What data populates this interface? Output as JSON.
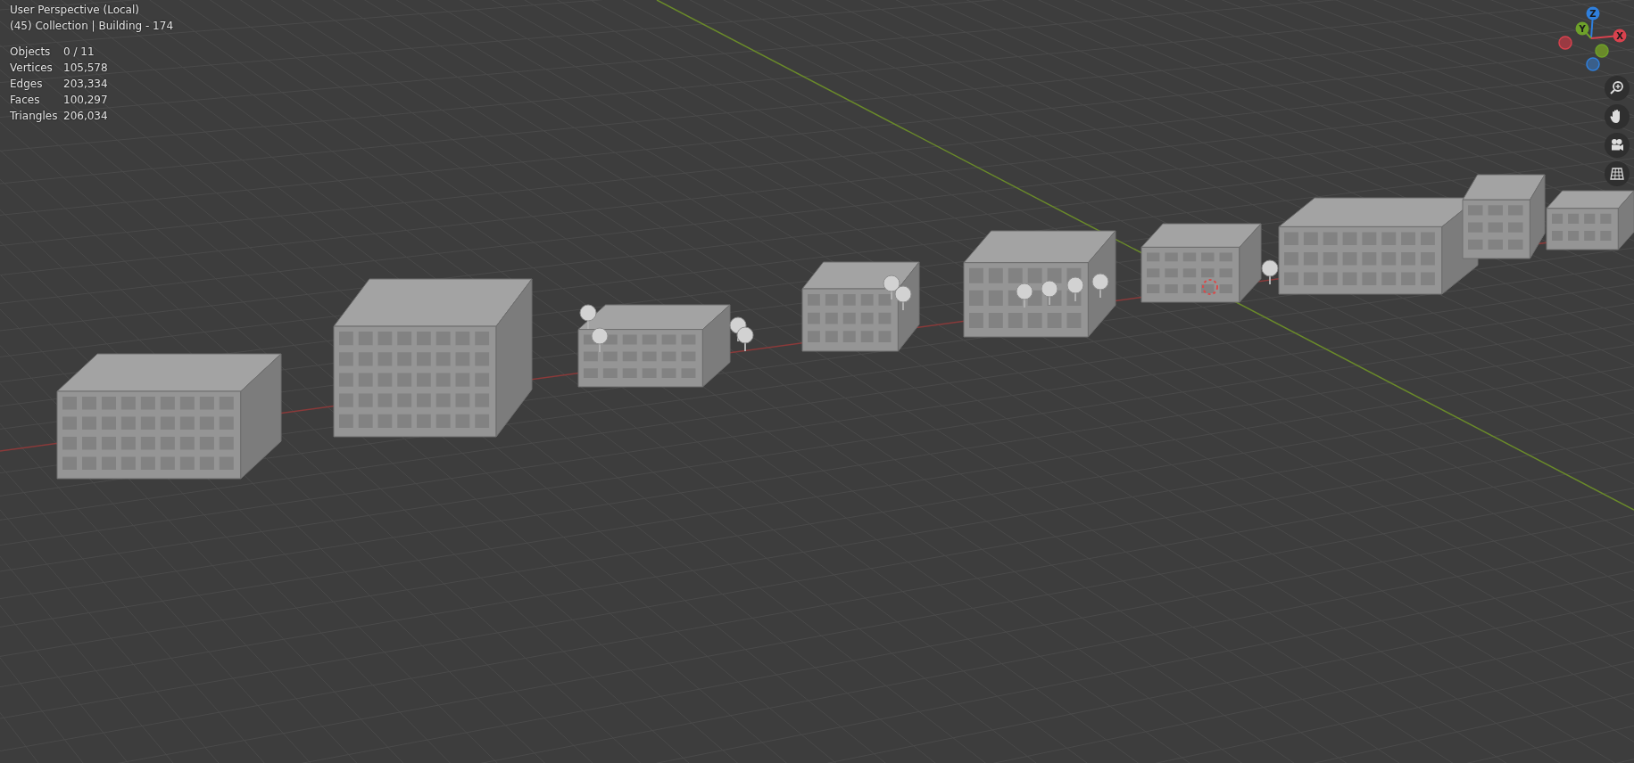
{
  "viewport": {
    "title": "User Perspective (Local)",
    "context": "(45) Collection | Building - 174"
  },
  "stats": [
    {
      "label": "Objects",
      "value": "0 / 11"
    },
    {
      "label": "Vertices",
      "value": "105,578"
    },
    {
      "label": "Edges",
      "value": "203,334"
    },
    {
      "label": "Faces",
      "value": "100,297"
    },
    {
      "label": "Triangles",
      "value": "206,034"
    }
  ],
  "gizmo": {
    "axes": [
      {
        "kind": "z",
        "label": "Z"
      },
      {
        "kind": "y",
        "label": "Y"
      },
      {
        "kind": "x",
        "label": "X"
      }
    ]
  },
  "nav_buttons": [
    {
      "kind": "zoom"
    },
    {
      "kind": "pan"
    },
    {
      "kind": "camera"
    },
    {
      "kind": "ortho"
    }
  ]
}
